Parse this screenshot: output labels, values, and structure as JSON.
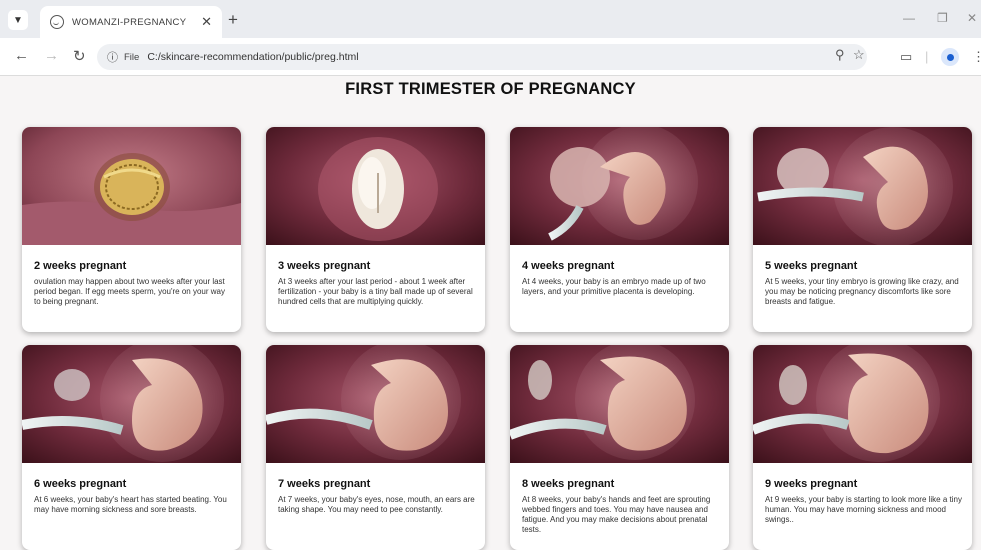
{
  "browser": {
    "tab_title": "WOMANZI-PREGNANCY",
    "scheme_label": "File",
    "url": "C:/skincare-recommendation/public/preg.html"
  },
  "page": {
    "title": "FIRST TRIMESTER OF PREGNANCY",
    "cards": [
      {
        "title": "2 weeks pregnant",
        "text": "ovulation may happen about two weeks after your last period began. If egg meets sperm, you're on your way to being pregnant."
      },
      {
        "title": "3 weeks pregnant",
        "text": "At 3 weeks after your last period - about 1 week after fertilization - your baby is a tiny ball made up of several hundred cells that are multiplying quickly."
      },
      {
        "title": "4 weeks pregnant",
        "text": "At 4 weeks, your baby is an embryo made up of two layers, and your primitive placenta is developing."
      },
      {
        "title": "5 weeks pregnant",
        "text": "At 5 weeks, your tiny embryo is growing like crazy, and you may be noticing pregnancy discomforts like sore breasts and fatigue."
      },
      {
        "title": "6 weeks pregnant",
        "text": "At 6 weeks, your baby's heart has started beating. You may have morning sickness and sore breasts."
      },
      {
        "title": "7 weeks pregnant",
        "text": "At 7 weeks, your baby's eyes, nose, mouth, an ears are taking shape. You may need to pee constantly."
      },
      {
        "title": "8 weeks pregnant",
        "text": "At 8 weeks, your baby's hands and feet are sprouting webbed fingers and toes. You may have nausea and fatigue. And you may make decisions about prenatal tests."
      },
      {
        "title": "9 weeks pregnant",
        "text": "At 9 weeks, your baby is starting to look more like a tiny human. You may have morning sickness and mood swings.."
      }
    ]
  }
}
